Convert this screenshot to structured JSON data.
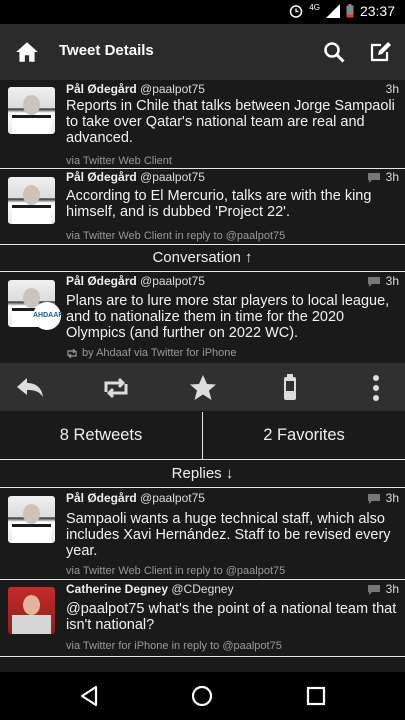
{
  "status": {
    "network": "4G",
    "time": "23:37"
  },
  "appbar": {
    "title": "Tweet Details"
  },
  "tweets": [
    {
      "author": "Pål Ødegård",
      "handle": "@paalpot75",
      "time": "3h",
      "text": "Reports in Chile that talks between Jorge Sampaoli to take over Qatar's national team are real and advanced.",
      "via": "via Twitter Web Client"
    },
    {
      "author": "Pål Ødegård",
      "handle": "@paalpot75",
      "time": "3h",
      "text": "According to El Mercurio, talks are with the king himself, and is dubbed 'Project 22'.",
      "via": "via Twitter Web Client in reply to @paalpot75"
    }
  ],
  "conversation_label": "Conversation ↑",
  "main_tweet": {
    "author": "Pål Ødegård",
    "handle": "@paalpot75",
    "time": "3h",
    "text": "Plans are to lure more star players to local league, and to nationalize them in time for the 2020 Olympics (and further on 2022 WC).",
    "retweet_info": "by Ahdaaf via Twitter for iPhone",
    "badge": "AHDAAF"
  },
  "stats": {
    "retweets": "8 Retweets",
    "favorites": "2 Favorites"
  },
  "replies_label": "Replies ↓",
  "replies": [
    {
      "author": "Pål Ødegård",
      "handle": "@paalpot75",
      "time": "3h",
      "text": "Sampaoli wants a huge technical staff, which also includes Xavi Hernández. Staff to be revised every year.",
      "via": "via Twitter Web Client in reply to @paalpot75"
    },
    {
      "author": "Catherine Degney",
      "handle": "@CDegney",
      "time": "3h",
      "text": "@paalpot75 what's the point of a national team that isn't national?",
      "via": "via Twitter for iPhone in reply to @paalpot75"
    }
  ]
}
